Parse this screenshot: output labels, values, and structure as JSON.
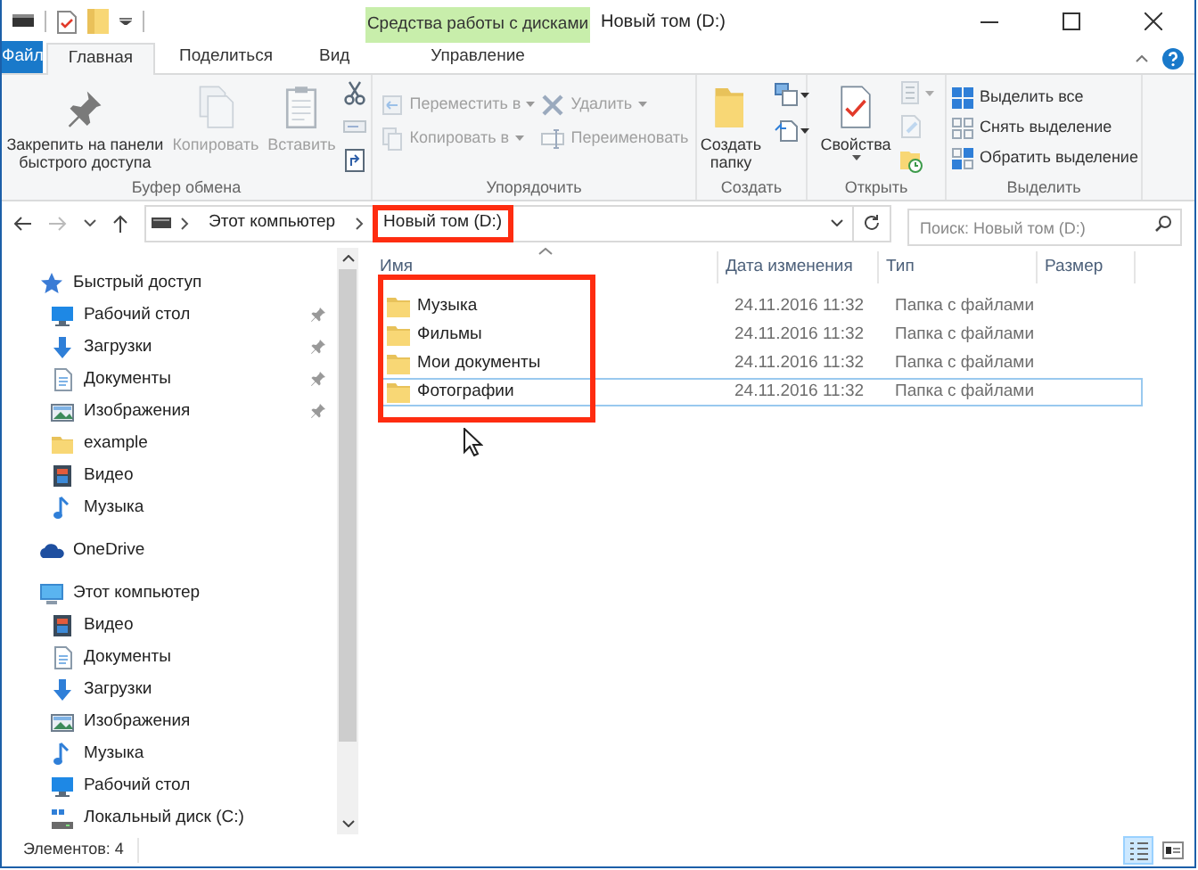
{
  "window": {
    "title": "Новый том (D:)"
  },
  "context_tab_group": {
    "label": "Средства работы с дисками"
  },
  "ribbon_tabs": [
    {
      "label": "Файл",
      "kind": "file",
      "selected": false
    },
    {
      "label": "Главная",
      "kind": "normal",
      "selected": true
    },
    {
      "label": "Поделиться",
      "kind": "normal",
      "selected": false
    },
    {
      "label": "Вид",
      "kind": "normal",
      "selected": false
    },
    {
      "label": "Управление",
      "kind": "context",
      "selected": false
    }
  ],
  "ribbon_groups": [
    {
      "label": "Буфер обмена",
      "columns": [
        [
          {
            "kind": "large",
            "label": "Закрепить на панели быстрого доступа",
            "disabled": false,
            "dropdown": false
          }
        ],
        [
          {
            "kind": "large",
            "label": "Копировать",
            "disabled": true,
            "dropdown": false
          }
        ],
        [
          {
            "kind": "large",
            "label": "Вставить",
            "disabled": true,
            "dropdown": false
          }
        ],
        [
          {
            "kind": "icon",
            "disabled": false,
            "dropdown": false
          },
          {
            "kind": "icon",
            "disabled": true,
            "dropdown": false
          },
          {
            "kind": "icon",
            "disabled": false,
            "dropdown": false
          }
        ]
      ]
    },
    {
      "label": "Упорядочить",
      "columns": [
        [
          {
            "kind": "small",
            "label": "Переместить в",
            "disabled": true,
            "dropdown": true
          },
          {
            "kind": "small",
            "label": "Копировать в",
            "disabled": true,
            "dropdown": true
          }
        ],
        [
          {
            "kind": "small",
            "label": "Удалить",
            "disabled": true,
            "dropdown": true
          },
          {
            "kind": "small",
            "label": "Переименовать",
            "disabled": true,
            "dropdown": false
          }
        ]
      ]
    },
    {
      "label": "Создать",
      "columns": [
        [
          {
            "kind": "large",
            "label": "Создать папку",
            "disabled": false,
            "dropdown": false
          }
        ],
        [
          {
            "kind": "icon",
            "disabled": false,
            "dropdown": true
          },
          {
            "kind": "icon",
            "disabled": false,
            "dropdown": true
          }
        ]
      ]
    },
    {
      "label": "Открыть",
      "columns": [
        [
          {
            "kind": "large",
            "label": "Свойства",
            "disabled": false,
            "dropdown": true
          }
        ],
        [
          {
            "kind": "icon",
            "disabled": true,
            "dropdown": true
          },
          {
            "kind": "icon",
            "disabled": true,
            "dropdown": false
          },
          {
            "kind": "icon",
            "disabled": false,
            "dropdown": false
          }
        ]
      ]
    },
    {
      "label": "Выделить",
      "columns": [
        [
          {
            "kind": "small",
            "label": "Выделить все",
            "disabled": false,
            "dropdown": false
          },
          {
            "kind": "small",
            "label": "Снять выделение",
            "disabled": false,
            "dropdown": false
          },
          {
            "kind": "small",
            "label": "Обратить выделение",
            "disabled": false,
            "dropdown": false
          }
        ]
      ]
    }
  ],
  "address_bar": {
    "crumbs": [
      {
        "label": "Этот компьютер",
        "highlighted": false
      },
      {
        "label": "Новый том (D:)",
        "highlighted": true
      }
    ]
  },
  "search": {
    "placeholder": "Поиск: Новый том (D:)"
  },
  "nav_tree": [
    {
      "label": "Быстрый доступ",
      "children": [
        {
          "label": "Рабочий стол",
          "pinned": true
        },
        {
          "label": "Загрузки",
          "pinned": true
        },
        {
          "label": "Документы",
          "pinned": true
        },
        {
          "label": "Изображения",
          "pinned": true
        },
        {
          "label": "example",
          "pinned": false
        },
        {
          "label": "Видео",
          "pinned": false
        },
        {
          "label": "Музыка",
          "pinned": false
        }
      ]
    },
    {
      "label": "OneDrive"
    },
    {
      "label": "Этот компьютер",
      "children": [
        {
          "label": "Видео"
        },
        {
          "label": "Документы"
        },
        {
          "label": "Загрузки"
        },
        {
          "label": "Изображения"
        },
        {
          "label": "Музыка"
        },
        {
          "label": "Рабочий стол"
        },
        {
          "label": "Локальный диск (C:)"
        }
      ]
    }
  ],
  "file_list": {
    "highlighted": true,
    "columns": [
      {
        "label": "Имя",
        "sorted": true
      },
      {
        "label": "Дата изменения",
        "sorted": false
      },
      {
        "label": "Тип",
        "sorted": false
      },
      {
        "label": "Размер",
        "sorted": false
      }
    ],
    "rows": [
      {
        "name": "Музыка",
        "modified": "24.11.2016 11:32",
        "type": "Папка с файлами",
        "focused": false
      },
      {
        "name": "Фильмы",
        "modified": "24.11.2016 11:32",
        "type": "Папка с файлами",
        "focused": false
      },
      {
        "name": "Мои документы",
        "modified": "24.11.2016 11:32",
        "type": "Папка с файлами",
        "focused": false
      },
      {
        "name": "Фотографии",
        "modified": "24.11.2016 11:32",
        "type": "Папка с файлами",
        "focused": true
      }
    ]
  },
  "status_bar": {
    "text": "Элементов: 4",
    "views": [
      {
        "kind": "details",
        "selected": true
      },
      {
        "kind": "tiles",
        "selected": false
      }
    ]
  }
}
